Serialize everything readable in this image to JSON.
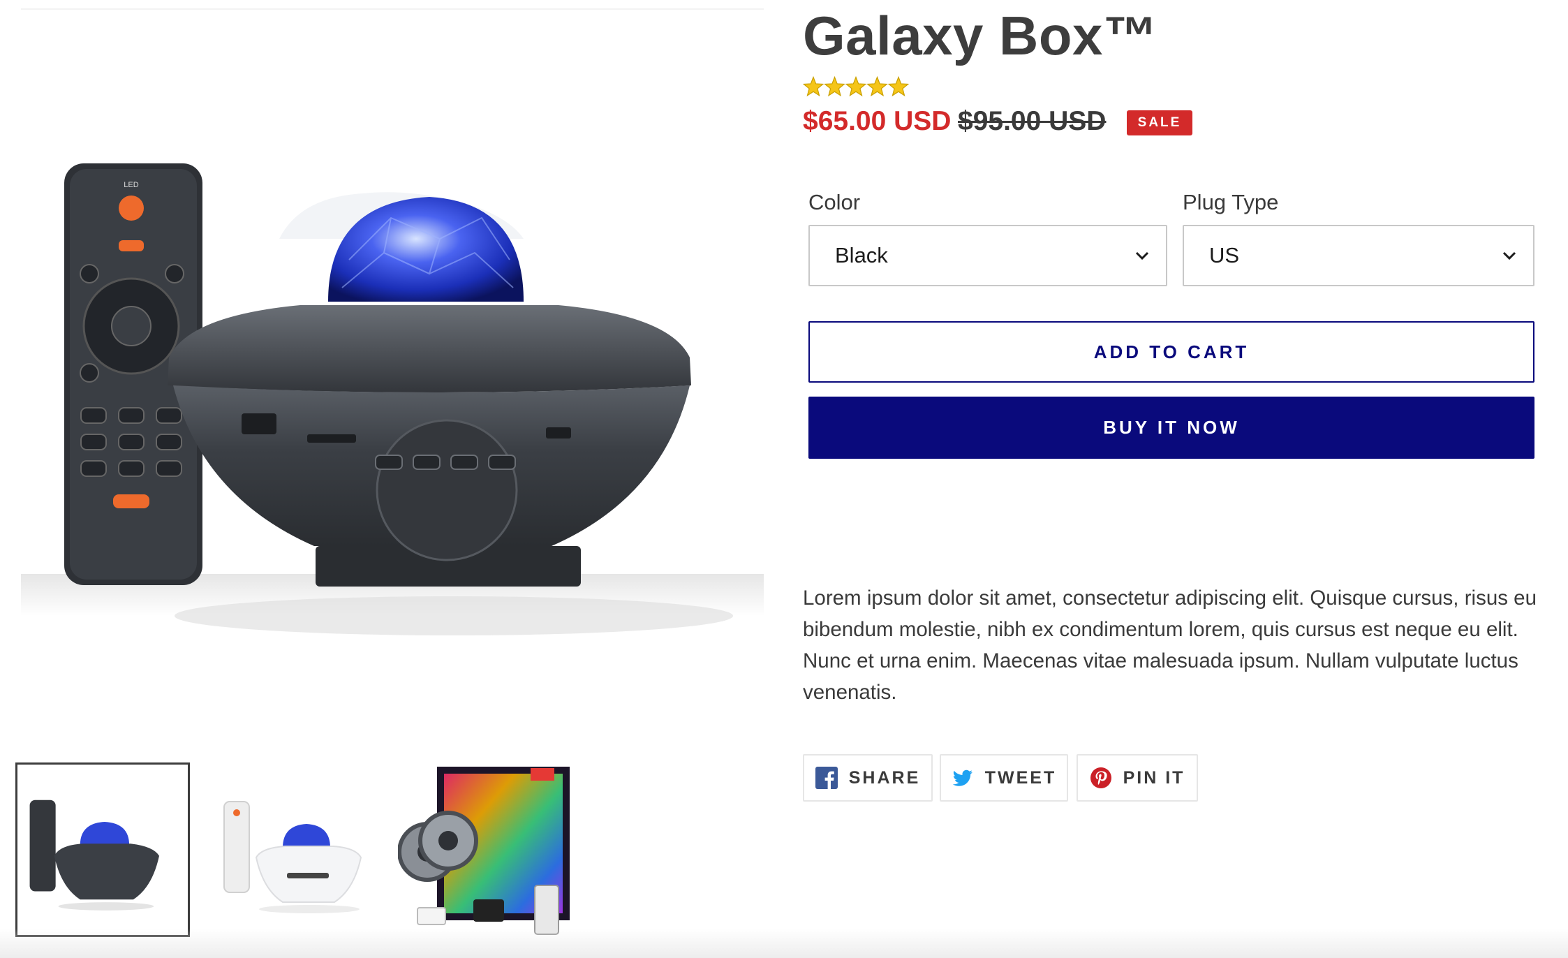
{
  "product": {
    "title": "Galaxy Box™",
    "rating": 5,
    "rating_max": 5,
    "sale_price": "$65.00 USD",
    "regular_price": "$95.00 USD",
    "sale_badge": "SALE",
    "description": "Lorem ipsum dolor sit amet, consectetur adipiscing elit. Quisque cursus, risus eu bibendum molestie, nibh ex condimentum lorem, quis cursus est neque eu elit. Nunc et urna enim. Maecenas vitae malesuada ipsum. Nullam vulputate luctus venenatis."
  },
  "options": {
    "color": {
      "label": "Color",
      "value": "Black"
    },
    "plug": {
      "label": "Plug Type",
      "value": "US"
    }
  },
  "buttons": {
    "add_to_cart": "ADD TO CART",
    "buy_now": "BUY IT NOW"
  },
  "share": {
    "facebook": "SHARE",
    "twitter": "TWEET",
    "pinterest": "PIN IT"
  },
  "colors": {
    "sale": "#d32a2a",
    "brand_navy": "#0a0a7c",
    "facebook": "#3b5998",
    "twitter": "#1da1f2",
    "pinterest": "#cb2027",
    "star": "#f5c518"
  },
  "icons": {
    "facebook": "facebook-icon",
    "twitter": "twitter-icon",
    "pinterest": "pinterest-icon",
    "select_arrow": "chevron-down-icon",
    "rating": "star-icon"
  }
}
